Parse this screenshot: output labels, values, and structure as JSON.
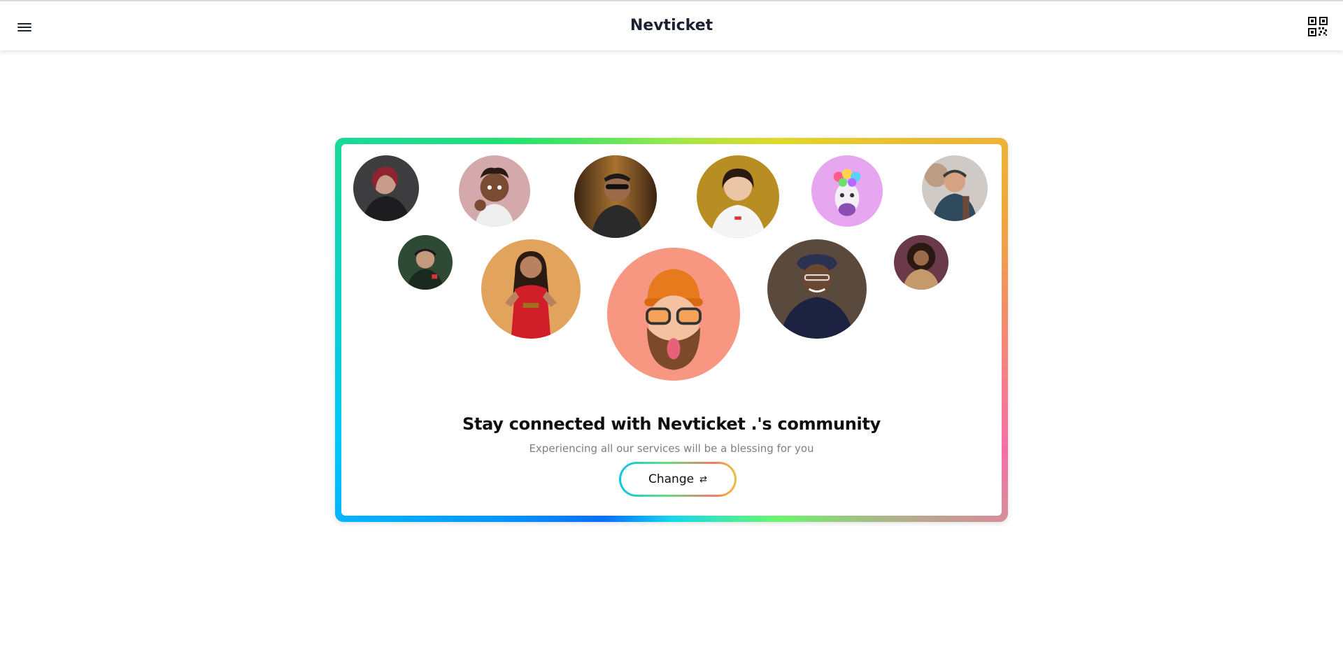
{
  "header": {
    "brand": "Nevticket",
    "menu_icon": "hamburger-menu-icon",
    "qr_icon": "qr-code-icon"
  },
  "community": {
    "headline": "Stay connected with Nevticket .'s community",
    "subline": "Experiencing all our services will be a blessing for you",
    "change_label": "Change",
    "change_icon": "swap-arrows-icon"
  },
  "colors": {
    "text_dark": "#1b2130",
    "subtext": "#7a7f88",
    "featured_avatar_bg": "#f79782"
  }
}
